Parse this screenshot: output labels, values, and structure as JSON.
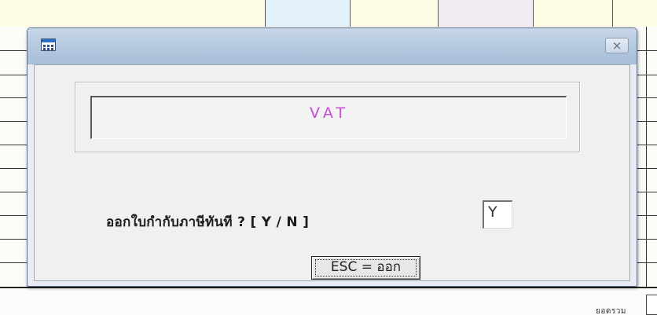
{
  "dialog": {
    "header_text": "VAT",
    "question": "ออกใบกำกับภาษีทันที ? [ Y / N ]",
    "answer_value": "Y",
    "esc_button_label": "ESC = ออก",
    "close_glyph": "⨯",
    "accent_color": "#c74ad6"
  },
  "footer": {
    "total_label": "ยอดรวม"
  },
  "icons": {
    "app": "window-app-icon",
    "close": "close-icon"
  }
}
